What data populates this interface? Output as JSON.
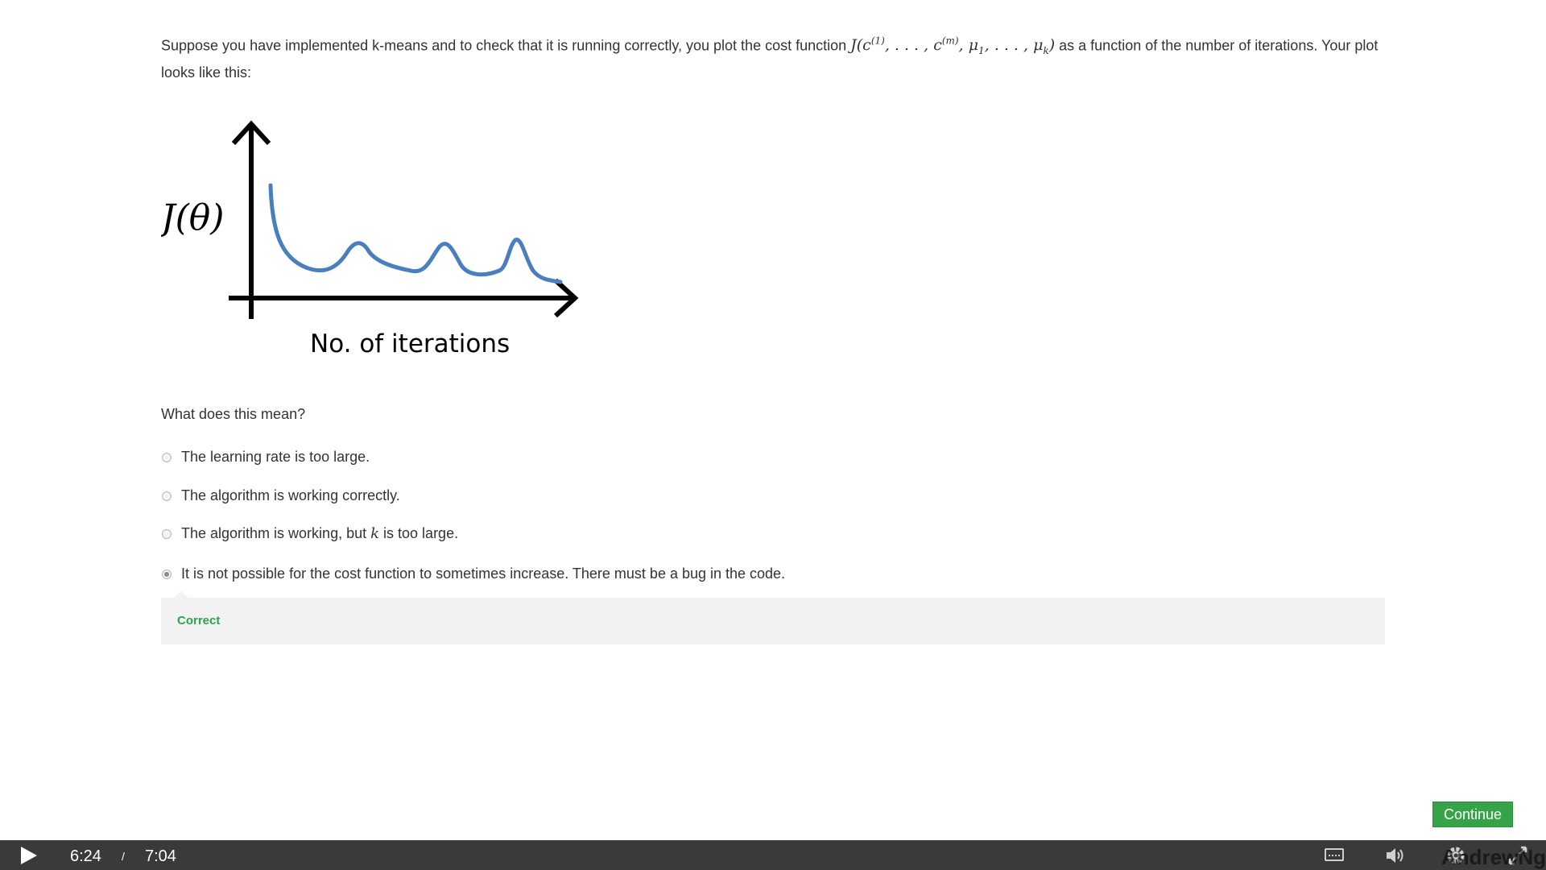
{
  "question": {
    "text_before": "Suppose you have implemented k-means and to check that it is running correctly, you plot the cost function ",
    "formula_parts": {
      "J_open": "J(c",
      "sup1": "(1)",
      "mid": ", . . . , c",
      "supm": "(m)",
      "mu_part": ", μ",
      "sub1": "1",
      "mu_dots": ", . . . , μ",
      "subk": "k",
      "close": ")"
    },
    "text_after": " as a function of the number of iterations. Your plot looks like this:"
  },
  "figure": {
    "y_label": "J(θ)",
    "x_label": "No. of iterations",
    "curve_color": "#4a7fbf",
    "axis_color": "#000000"
  },
  "prompt": "What does this mean?",
  "options": [
    {
      "label": "The learning rate is too large.",
      "selected": false
    },
    {
      "label": "The algorithm is working correctly.",
      "selected": false
    },
    {
      "label_before": "The algorithm is working, but ",
      "label_var": "k",
      "label_after": " is too large.",
      "selected": false
    },
    {
      "label": "It is not possible for the cost function to sometimes increase. There must be a bug in the code.",
      "selected": true
    }
  ],
  "feedback": {
    "label": "Correct",
    "color": "#2ea44f"
  },
  "continue_button": {
    "label": "Continue",
    "color": "#37a349"
  },
  "player": {
    "current_time": "6:24",
    "separator": "/",
    "duration": "7:04",
    "icons": [
      "play-icon",
      "captions-icon",
      "volume-icon",
      "settings-gear-icon",
      "fullscreen-icon"
    ],
    "watermark": "AndrewNg"
  }
}
